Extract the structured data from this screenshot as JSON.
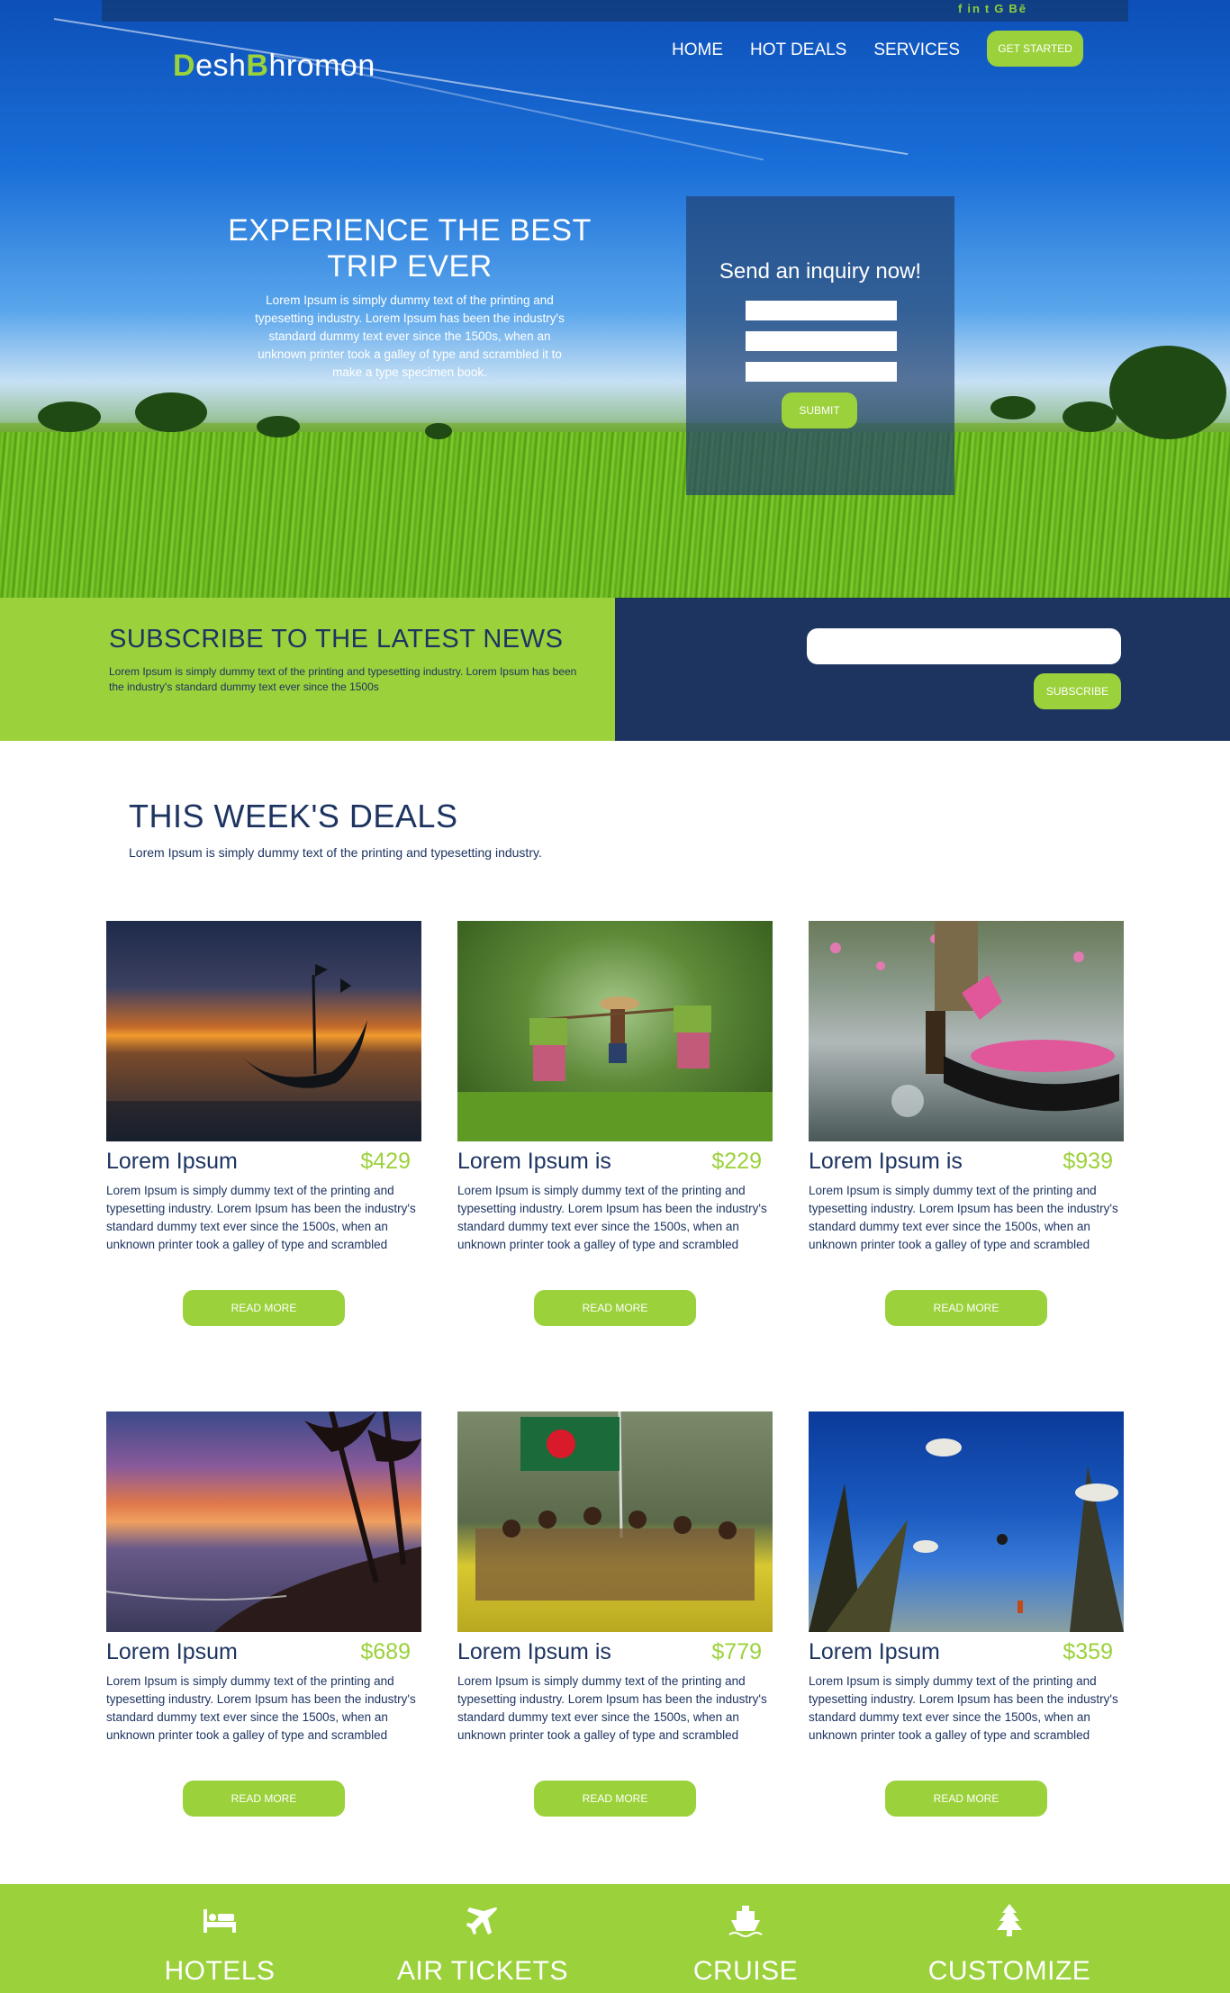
{
  "header": {
    "social": [
      "f",
      "in",
      "t",
      "G",
      "Bē"
    ],
    "logo": {
      "first_initial": "D",
      "first_rest": "esh",
      "second_initial": "B",
      "second_rest": "hromon"
    },
    "nav": [
      "HOME",
      "HOT DEALS",
      "SERVICES"
    ],
    "cta": "GET STARTED"
  },
  "hero": {
    "title": "EXPERIENCE THE BEST TRIP EVER",
    "text": "Lorem Ipsum is simply dummy text of the printing and typesetting industry. Lorem Ipsum has been the industry's standard dummy text ever since the 1500s, when an unknown printer took a galley of type and scrambled it to make a type specimen book."
  },
  "inquiry": {
    "title": "Send an inquiry now!",
    "fields": [
      "",
      "",
      ""
    ],
    "submit": "SUBMIT"
  },
  "subscribe": {
    "title": "SUBSCRIBE TO THE LATEST NEWS",
    "text": "Lorem Ipsum is simply dummy text of the printing and typesetting industry. Lorem Ipsum has been the industry's standard dummy text ever since the 1500s",
    "input_value": "",
    "button": "SUBSCRIBE"
  },
  "deals": {
    "title": "THIS WEEK'S DEALS",
    "subtitle": "Lorem Ipsum is simply dummy text of the printing and typesetting industry.",
    "cards": [
      {
        "name": "Lorem Ipsum",
        "price": "$429",
        "image": "boat-sunset",
        "desc": "Lorem Ipsum is simply dummy text of the printing and typesetting industry. Lorem Ipsum has been the industry's standard dummy text ever since the 1500s, when an unknown printer took a galley of type and scrambled",
        "button": "READ MORE"
      },
      {
        "name": "Lorem Ipsum is",
        "price": "$229",
        "image": "rice-farmer",
        "desc": "Lorem Ipsum is simply dummy text of the printing and typesetting industry. Lorem Ipsum has been the industry's standard dummy text ever since the 1500s, when an unknown printer took a galley of type and scrambled",
        "button": "READ MORE"
      },
      {
        "name": "Lorem Ipsum is",
        "price": "$939",
        "image": "lotus-boat",
        "desc": "Lorem Ipsum is simply dummy text of the printing and typesetting industry. Lorem Ipsum has been the industry's standard dummy text ever since the 1500s, when an unknown printer took a galley of type and scrambled",
        "button": "READ MORE"
      },
      {
        "name": "Lorem Ipsum",
        "price": "$689",
        "image": "palm-beach-sunset",
        "desc": "Lorem Ipsum is simply dummy text of the printing and typesetting industry. Lorem Ipsum has been the industry's standard dummy text ever since the 1500s, when an unknown printer took a galley of type and scrambled",
        "button": "READ MORE"
      },
      {
        "name": "Lorem Ipsum is",
        "price": "$779",
        "image": "children-flag",
        "desc": "Lorem Ipsum is simply dummy text of the printing and typesetting industry. Lorem Ipsum has been the industry's standard dummy text ever since the 1500s, when an unknown printer took a galley of type and scrambled",
        "button": "READ MORE"
      },
      {
        "name": "Lorem Ipsum",
        "price": "$359",
        "image": "kash-flowers-sky",
        "desc": "Lorem Ipsum is simply dummy text of the printing and typesetting industry. Lorem Ipsum has been the industry's standard dummy text ever since the 1500s, when an unknown printer took a galley of type and scrambled",
        "button": "READ MORE"
      }
    ]
  },
  "services": [
    {
      "label": "HOTELS",
      "icon": "bed-icon"
    },
    {
      "label": "AIR TICKETS",
      "icon": "plane-icon"
    },
    {
      "label": "CRUISE",
      "icon": "ship-icon"
    },
    {
      "label": "CUSTOMIZE",
      "icon": "tree-icon"
    }
  ],
  "colors": {
    "accent": "#9bd13b",
    "navy": "#1d3461",
    "white": "#ffffff"
  }
}
